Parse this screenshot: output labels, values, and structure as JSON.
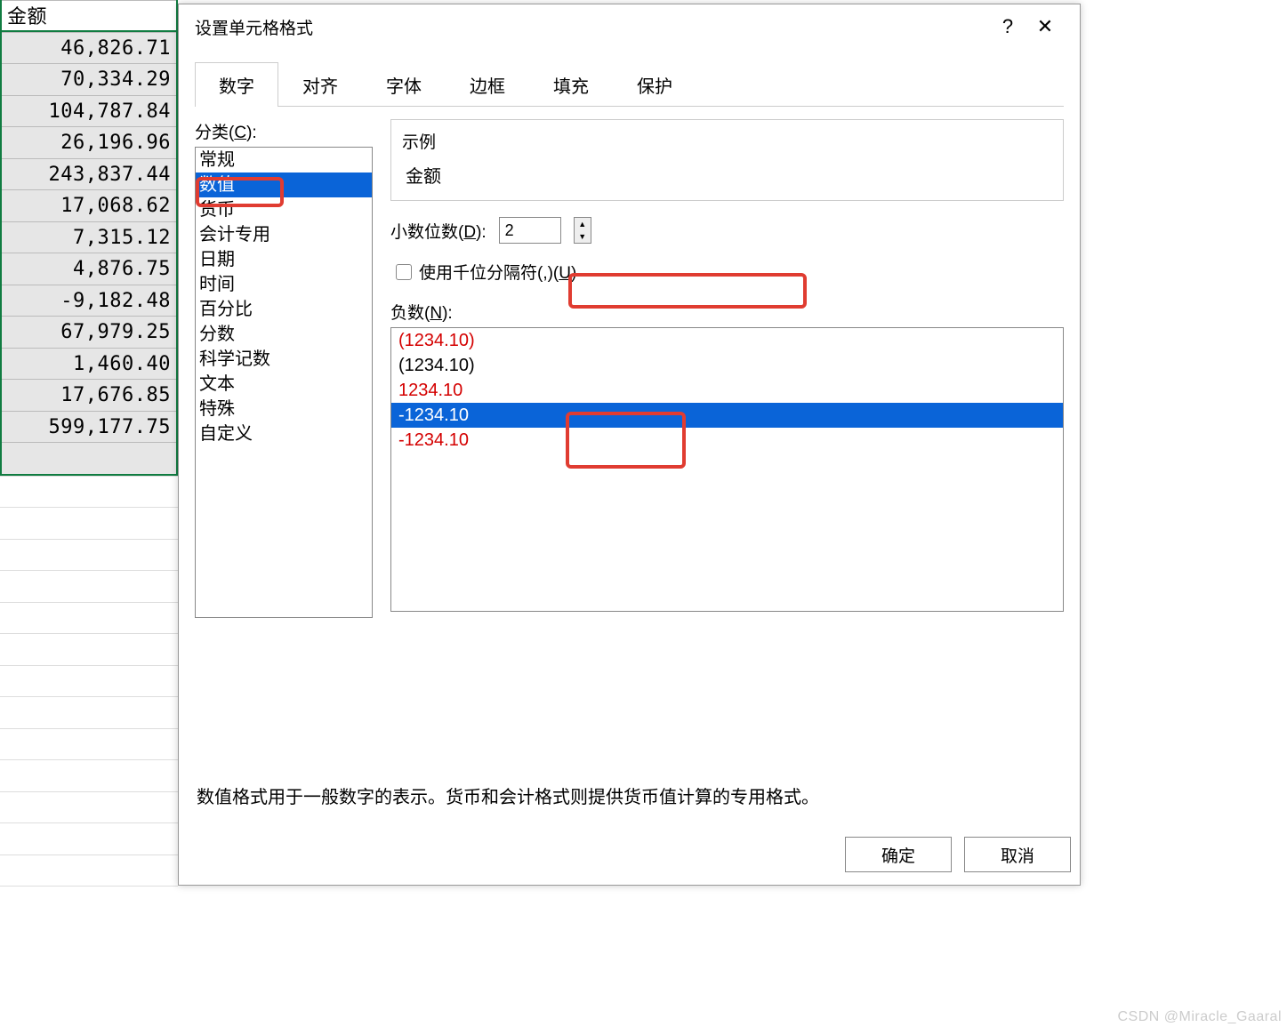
{
  "sheet": {
    "header": "金额",
    "values": [
      "46,826.71",
      "70,334.29",
      "104,787.84",
      "26,196.96",
      "243,837.44",
      "17,068.62",
      "7,315.12",
      "4,876.75",
      "-9,182.48",
      "67,979.25",
      "1,460.40",
      "17,676.85",
      "599,177.75"
    ],
    "blank_rows": 14
  },
  "dialog": {
    "title": "设置单元格格式",
    "help_icon": "?",
    "close_icon": "✕",
    "tabs": [
      "数字",
      "对齐",
      "字体",
      "边框",
      "填充",
      "保护"
    ],
    "active_tab_index": 0,
    "category_label_prefix": "分类(",
    "category_label_u": "C",
    "category_label_suffix": "):",
    "categories": [
      "常规",
      "数值",
      "货币",
      "会计专用",
      "日期",
      "时间",
      "百分比",
      "分数",
      "科学记数",
      "文本",
      "特殊",
      "自定义"
    ],
    "selected_category_index": 1,
    "example": {
      "label": "示例",
      "value": "金额"
    },
    "decimal_label_prefix": "小数位数(",
    "decimal_label_u": "D",
    "decimal_label_suffix": "):",
    "decimal_value": "2",
    "separator_label_prefix": "使用千位分隔符(,)(",
    "separator_label_u": "U",
    "separator_label_suffix": ")",
    "separator_checked": false,
    "negative_label_prefix": "负数(",
    "negative_label_u": "N",
    "negative_label_suffix": "):",
    "negative_options": [
      {
        "text": "(1234.10)",
        "red": true
      },
      {
        "text": "(1234.10)",
        "red": false
      },
      {
        "text": "1234.10",
        "red": true
      },
      {
        "text": "-1234.10",
        "red": false,
        "selected": true
      },
      {
        "text": "-1234.10",
        "red": true
      }
    ],
    "description": "数值格式用于一般数字的表示。货币和会计格式则提供货币值计算的专用格式。",
    "ok_label": "确定",
    "cancel_label": "取消"
  },
  "watermark": "CSDN @Miracle_Gaaral"
}
